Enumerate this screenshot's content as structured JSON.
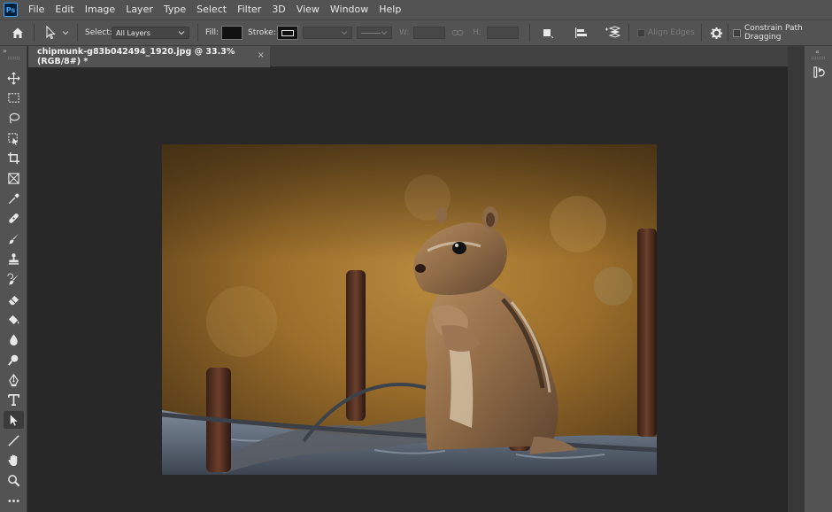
{
  "menu": {
    "app_logo": "Ps",
    "items": [
      "File",
      "Edit",
      "Image",
      "Layer",
      "Type",
      "Select",
      "Filter",
      "3D",
      "View",
      "Window",
      "Help"
    ]
  },
  "options": {
    "select_label": "Select:",
    "select_value": "All Layers",
    "fill_label": "Fill:",
    "stroke_label": "Stroke:",
    "w_label": "W:",
    "h_label": "H:",
    "align_edges_label": "Align Edges",
    "constrain_label": "Constrain Path Dragging"
  },
  "document": {
    "tab_title": "chipmunk-g83b042494_1920.jpg @ 33.3% (RGB/8#) *",
    "close_glyph": "×"
  },
  "tools": [
    "move-tool-icon",
    "marquee-tool-icon",
    "lasso-tool-icon",
    "object-select-tool-icon",
    "crop-tool-icon",
    "frame-tool-icon",
    "eyedropper-tool-icon",
    "healing-brush-tool-icon",
    "brush-tool-icon",
    "clone-stamp-tool-icon",
    "history-brush-tool-icon",
    "eraser-tool-icon",
    "paint-bucket-tool-icon",
    "blur-tool-icon",
    "dodge-tool-icon",
    "pen-tool-icon",
    "type-tool-icon",
    "path-selection-tool-icon",
    "line-tool-icon",
    "hand-tool-icon",
    "zoom-tool-icon",
    "more-tools-icon"
  ],
  "colors": {
    "chrome": "#535353",
    "canvas_bg": "#282828",
    "accent": "#31a8ff"
  }
}
